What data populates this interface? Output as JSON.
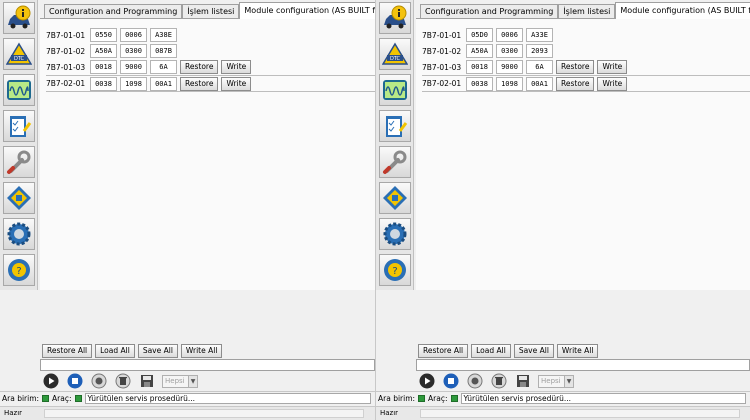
{
  "panes": [
    {
      "id": "left",
      "tabs": [
        "Configuration and Programming",
        "İşlem listesi",
        "Module configuration (AS BUILT format)"
      ],
      "rows": [
        {
          "label": "7B7-01-01",
          "cells": [
            "0550",
            "0006",
            "A38E"
          ],
          "buttons": []
        },
        {
          "label": "7B7-01-02",
          "cells": [
            "A50A",
            "0300",
            "087B"
          ],
          "buttons": []
        },
        {
          "label": "7B7-01-03",
          "cells": [
            "0018",
            "9000",
            "6A"
          ],
          "buttons": [
            "Restore",
            "Write"
          ]
        },
        {
          "label": "7B7-02-01",
          "cells": [
            "0038",
            "1098",
            "00A1"
          ],
          "buttons": [
            "Restore",
            "Write"
          ]
        }
      ],
      "bottom_buttons": [
        "Restore All",
        "Load All",
        "Save All",
        "Write All"
      ],
      "select": "Hepsi",
      "status": {
        "ara_birim": "Ara birim:",
        "arac": "Araç:",
        "text": "Yürütülen servis prosedürü..."
      },
      "footer": "Hazır"
    },
    {
      "id": "right",
      "tabs": [
        "Configuration and Programming",
        "İşlem listesi",
        "Module configuration (AS BUILT format)"
      ],
      "rows": [
        {
          "label": "7B7-01-01",
          "cells": [
            "05D0",
            "0006",
            "A33E"
          ],
          "buttons": []
        },
        {
          "label": "7B7-01-02",
          "cells": [
            "A50A",
            "0300",
            "2093"
          ],
          "buttons": []
        },
        {
          "label": "7B7-01-03",
          "cells": [
            "0018",
            "9000",
            "6A"
          ],
          "buttons": [
            "Restore",
            "Write"
          ]
        },
        {
          "label": "7B7-02-01",
          "cells": [
            "0038",
            "1098",
            "00A1"
          ],
          "buttons": [
            "Restore",
            "Write"
          ]
        }
      ],
      "bottom_buttons": [
        "Restore All",
        "Load All",
        "Save All",
        "Write All"
      ],
      "select": "Hepsi",
      "status": {
        "ara_birim": "Ara birim:",
        "arac": "Araç:",
        "text": "Yürütülen servis prosedürü..."
      },
      "footer": "Hazır"
    }
  ],
  "icons": {
    "sidebar": [
      "vehicle-info-icon",
      "dtc-icon",
      "oscilloscope-icon",
      "checklist-icon",
      "wrench-icon",
      "module-programming-icon",
      "settings-gear-icon",
      "help-steering-icon"
    ],
    "controls": [
      "play-icon",
      "stop-icon",
      "record-icon",
      "delete-icon",
      "save-icon"
    ]
  },
  "colors": {
    "status_green": "#2e9a3c",
    "dtc_yellow": "#f2c400",
    "blue_button": "#1e5fb8"
  }
}
